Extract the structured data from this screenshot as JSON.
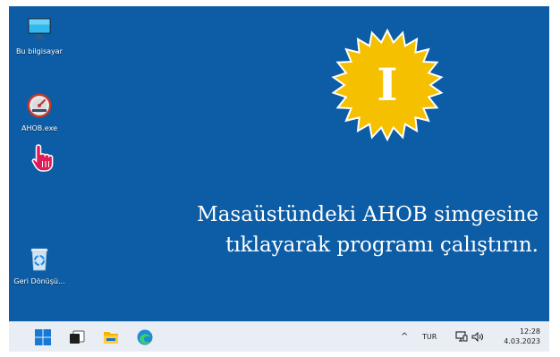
{
  "desktop_icons": [
    {
      "label": "Bu bilgisayar",
      "icon": "monitor-icon"
    },
    {
      "label": "AHOB.exe",
      "icon": "ahob-app-icon"
    },
    {
      "label": "Geri Dönüşü...",
      "icon": "recycle-bin-icon"
    }
  ],
  "badge": {
    "text": "I",
    "icon": "starburst-badge-icon"
  },
  "instruction": {
    "line1": "Masaüstündeki AHOB simgesine",
    "line2": "tıklayarak programı çalıştırın."
  },
  "pointer": {
    "icon": "hand-pointer-icon"
  },
  "taskbar": {
    "apps": [
      "windows-start-icon",
      "task-view-icon",
      "file-explorer-icon",
      "edge-browser-icon"
    ],
    "tray": {
      "chevron": "^",
      "language": "TUR",
      "network": "network-icon",
      "volume": "volume-icon"
    },
    "clock": {
      "time": "12:28",
      "date": "4.03.2023"
    }
  },
  "colors": {
    "desktop_bg": "#0d5da6",
    "badge_yellow": "#f5c000",
    "badge_text": "#ffffff",
    "pointer": "#e01b5a"
  }
}
